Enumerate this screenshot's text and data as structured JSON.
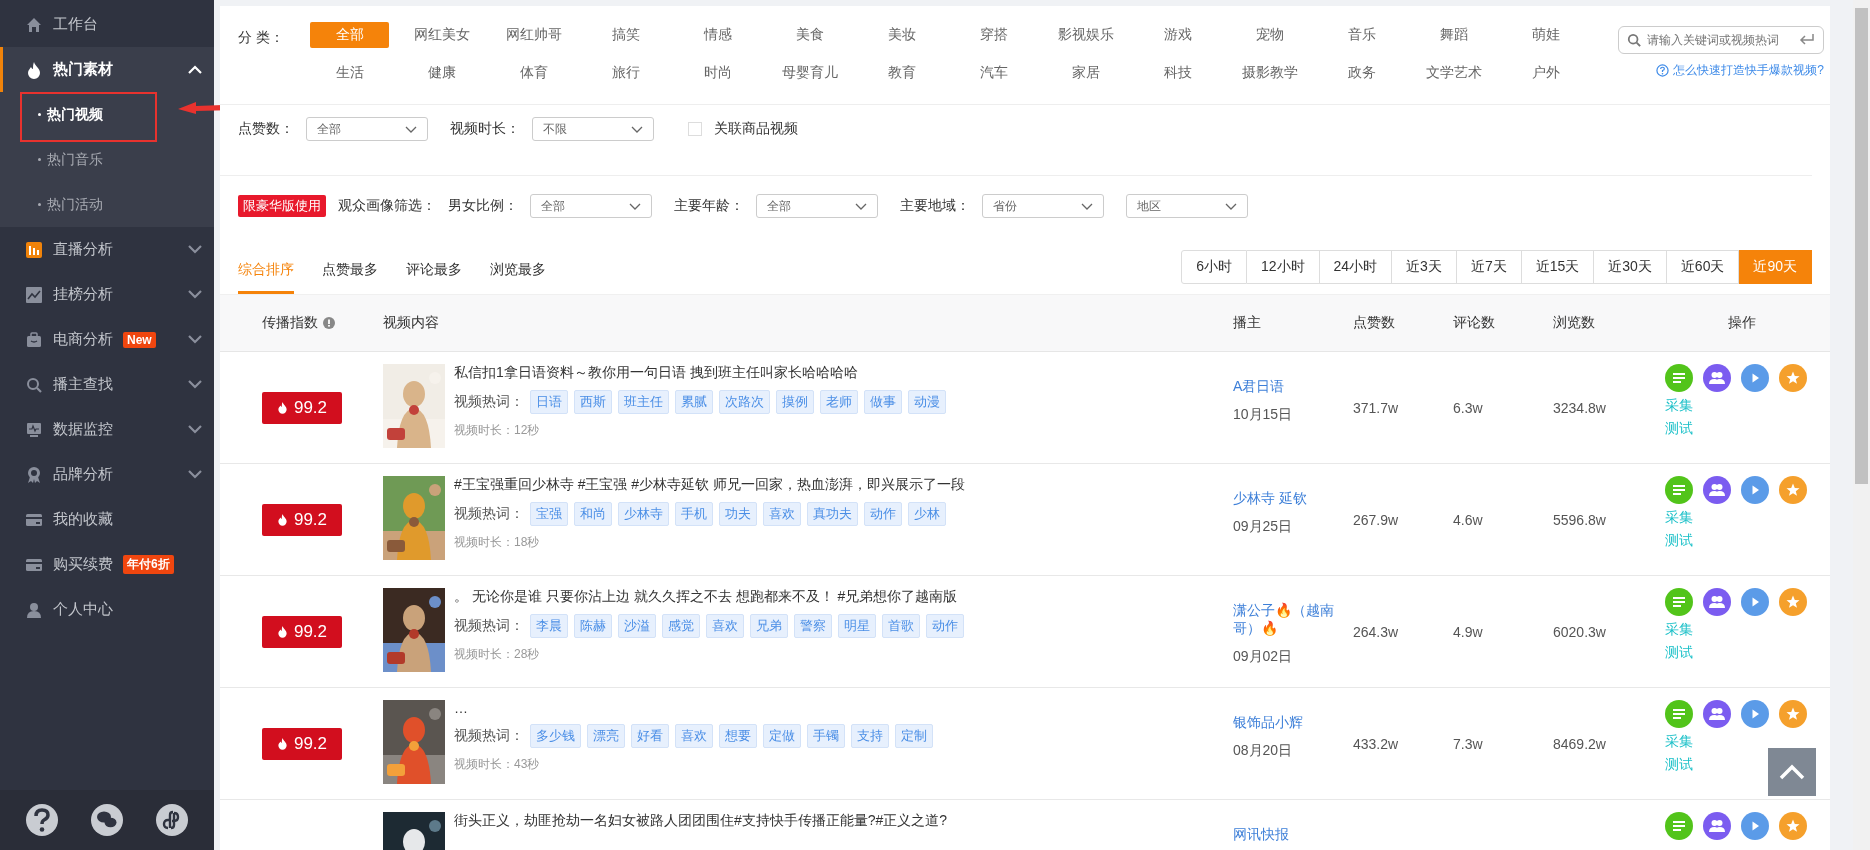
{
  "sidebar": {
    "items": [
      {
        "label": "工作台",
        "selected": false
      },
      {
        "label": "热门素材",
        "selected": true,
        "expanded": true,
        "children": [
          {
            "label": "热门视频",
            "selected": true
          },
          {
            "label": "热门音乐",
            "selected": false
          },
          {
            "label": "热门活动",
            "selected": false
          }
        ]
      },
      {
        "label": "直播分析",
        "selected": false,
        "expanded": false
      },
      {
        "label": "挂榜分析",
        "selected": false,
        "expanded": false
      },
      {
        "label": "电商分析",
        "selected": false,
        "expanded": false,
        "badge": "New"
      },
      {
        "label": "播主查找",
        "selected": false,
        "expanded": false
      },
      {
        "label": "数据监控",
        "selected": false,
        "expanded": false
      },
      {
        "label": "品牌分析",
        "selected": false,
        "expanded": false
      },
      {
        "label": "我的收藏",
        "selected": false
      },
      {
        "label": "购买续费",
        "selected": false,
        "badge": "年付6折"
      },
      {
        "label": "个人中心",
        "selected": false
      }
    ]
  },
  "filters": {
    "category_label": "分 类：",
    "categories": [
      {
        "label": "全部",
        "selected": true
      },
      {
        "label": "网红美女",
        "selected": false
      },
      {
        "label": "网红帅哥",
        "selected": false
      },
      {
        "label": "搞笑",
        "selected": false
      },
      {
        "label": "情感",
        "selected": false
      },
      {
        "label": "美食",
        "selected": false
      },
      {
        "label": "美妆",
        "selected": false
      },
      {
        "label": "穿搭",
        "selected": false
      },
      {
        "label": "影视娱乐",
        "selected": false
      },
      {
        "label": "游戏",
        "selected": false
      },
      {
        "label": "宠物",
        "selected": false
      },
      {
        "label": "音乐",
        "selected": false
      },
      {
        "label": "舞蹈",
        "selected": false
      },
      {
        "label": "萌娃",
        "selected": false
      },
      {
        "label": "生活",
        "selected": false
      },
      {
        "label": "健康",
        "selected": false
      },
      {
        "label": "体育",
        "selected": false
      },
      {
        "label": "旅行",
        "selected": false
      },
      {
        "label": "时尚",
        "selected": false
      },
      {
        "label": "母婴育儿",
        "selected": false
      },
      {
        "label": "教育",
        "selected": false
      },
      {
        "label": "汽车",
        "selected": false
      },
      {
        "label": "家居",
        "selected": false
      },
      {
        "label": "科技",
        "selected": false
      },
      {
        "label": "摄影教学",
        "selected": false
      },
      {
        "label": "政务",
        "selected": false
      },
      {
        "label": "文学艺术",
        "selected": false
      },
      {
        "label": "户外",
        "selected": false
      }
    ],
    "search": {
      "placeholder": "请输入关键词或视频热词"
    },
    "help_link": "怎么快速打造快手爆款视频?",
    "selects": [
      {
        "label": "点赞数：",
        "value": "全部"
      },
      {
        "label": "视频时长：",
        "value": "不限"
      }
    ],
    "product_checkbox": {
      "label": "关联商品视频",
      "checked": false
    },
    "deluxe_badge": "限豪华版使用",
    "audience_label": "观众画像筛选：",
    "audience_selects": [
      {
        "label": "男女比例：",
        "value": "全部"
      },
      {
        "label": "主要年龄：",
        "value": "全部"
      },
      {
        "label": "主要地域：",
        "value": "省份"
      },
      {
        "value": "地区"
      }
    ]
  },
  "sort_tabs": [
    {
      "label": "综合排序",
      "selected": true
    },
    {
      "label": "点赞最多",
      "selected": false
    },
    {
      "label": "评论最多",
      "selected": false
    },
    {
      "label": "浏览最多",
      "selected": false
    }
  ],
  "time_ranges": [
    {
      "label": "6小时",
      "selected": false
    },
    {
      "label": "12小时",
      "selected": false
    },
    {
      "label": "24小时",
      "selected": false
    },
    {
      "label": "近3天",
      "selected": false
    },
    {
      "label": "近7天",
      "selected": false
    },
    {
      "label": "近15天",
      "selected": false
    },
    {
      "label": "近30天",
      "selected": false
    },
    {
      "label": "近60天",
      "selected": false
    },
    {
      "label": "近90天",
      "selected": true
    }
  ],
  "table": {
    "columns": [
      "传播指数",
      "视频内容",
      "播主",
      "点赞数",
      "评论数",
      "浏览数",
      "操作"
    ],
    "rows": [
      {
        "score": "99.2",
        "title": "私信扣1拿日语资料～教你用一句日语 拽到班主任叫家长哈哈哈哈",
        "hot_label": "视频热词：",
        "tags": [
          "日语",
          "西斯",
          "班主任",
          "累腻",
          "次路次",
          "摸例",
          "老师",
          "做事",
          "动漫"
        ],
        "duration": "视频时长：12秒",
        "author": "A君日语",
        "date": "10月15日",
        "likes": "371.7w",
        "comments": "6.3w",
        "views": "3234.8w",
        "actions": [
          "采集",
          "测试"
        ]
      },
      {
        "score": "99.2",
        "title": "#王宝强重回少林寺 #王宝强 #少林寺延钦 师兄一回家，热血澎湃，即兴展示了一段",
        "hot_label": "视频热词：",
        "tags": [
          "宝强",
          "和尚",
          "少林寺",
          "手机",
          "功夫",
          "喜欢",
          "真功夫",
          "动作",
          "少林"
        ],
        "duration": "视频时长：18秒",
        "author": "少林寺 延钦",
        "date": "09月25日",
        "likes": "267.9w",
        "comments": "4.6w",
        "views": "5596.8w",
        "actions": [
          "采集",
          "测试"
        ]
      },
      {
        "score": "99.2",
        "title": "。 无论你是谁 只要你沾上边 就久久挥之不去 想跑都来不及！ #兄弟想你了越南版",
        "hot_label": "视频热词：",
        "tags": [
          "李晨",
          "陈赫",
          "沙溢",
          "感觉",
          "喜欢",
          "兄弟",
          "警察",
          "明星",
          "首歌",
          "动作"
        ],
        "duration": "视频时长：28秒",
        "author": "潇公子🔥（越南哥）🔥",
        "date": "09月02日",
        "likes": "264.3w",
        "comments": "4.9w",
        "views": "6020.3w",
        "actions": [
          "采集",
          "测试"
        ]
      },
      {
        "score": "99.2",
        "title": "…",
        "hot_label": "视频热词：",
        "tags": [
          "多少钱",
          "漂亮",
          "好看",
          "喜欢",
          "想要",
          "定做",
          "手镯",
          "支持",
          "定制"
        ],
        "duration": "视频时长：43秒",
        "author": "银饰品小辉",
        "date": "08月20日",
        "likes": "433.2w",
        "comments": "7.3w",
        "views": "8469.2w",
        "actions": [
          "采集",
          "测试"
        ]
      },
      {
        "title": "街头正义，劫匪抢劫一名妇女被路人团团围住#支持快手传播正能量?#正义之道?",
        "author": "网讯快报"
      }
    ]
  }
}
